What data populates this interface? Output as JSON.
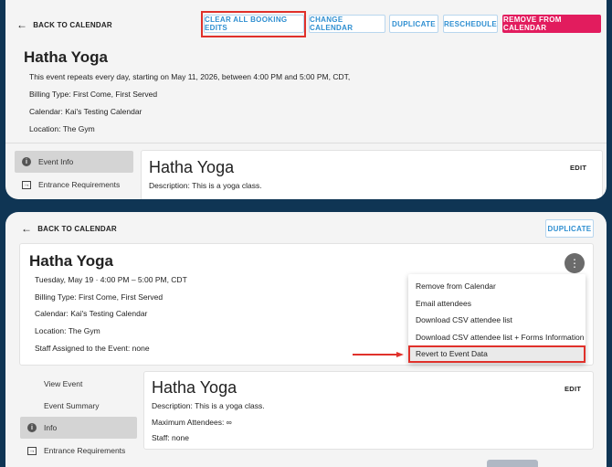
{
  "panel1": {
    "back_label": "BACK TO CALENDAR",
    "toolbar": {
      "clear_label": "CLEAR ALL BOOKING EDITS",
      "change_label": "CHANGE CALENDAR",
      "duplicate_label": "DUPLICATE",
      "reschedule_label": "RESCHEDULE",
      "remove_label": "REMOVE FROM CALENDAR"
    },
    "event_title": "Hatha Yoga",
    "repeat_text": "This event repeats every day, starting on May 11, 2026, between 4:00 PM and 5:00 PM, CDT,",
    "billing": "Billing Type: First Come, First Served",
    "calendar": "Calendar: Kai's Testing Calendar",
    "location": "Location: The Gym",
    "sidebar": [
      {
        "label": "Event Info"
      },
      {
        "label": "Entrance Requirements"
      }
    ],
    "detail_title": "Hatha Yoga",
    "edit_label": "EDIT",
    "description": "Description:  This is a yoga class."
  },
  "panel2": {
    "back_label": "BACK TO CALENDAR",
    "duplicate_label": "DUPLICATE",
    "event_title": "Hatha Yoga",
    "date_text": "Tuesday, May 19   ·   4:00 PM – 5:00 PM, CDT",
    "billing": "Billing Type: First Come, First Served",
    "calendar": "Calendar: Kai's Testing Calendar",
    "location": "Location: The Gym",
    "staff_assigned": "Staff Assigned to the Event: none",
    "menu": [
      {
        "label": "Remove from Calendar"
      },
      {
        "label": "Email attendees"
      },
      {
        "label": "Download CSV attendee list"
      },
      {
        "label": "Download CSV attendee list + Forms Information"
      },
      {
        "label": "Revert to Event Data"
      }
    ],
    "sidebar": [
      {
        "label": "View Event"
      },
      {
        "label": "Event Summary"
      },
      {
        "label": "Info"
      },
      {
        "label": "Entrance Requirements"
      }
    ],
    "detail_title": "Hatha Yoga",
    "edit_label": "EDIT",
    "description": "Description:  This is a yoga class.",
    "max_attendees": "Maximum Attendees: ∞",
    "staff": "Staff: none"
  },
  "colors": {
    "background": "#0f3554",
    "accent_blue": "#2f8fd1",
    "danger": "#e21c5e",
    "highlight_red": "#e0312b"
  },
  "icons": [
    "back-arrow-icon",
    "info-icon",
    "entrance-icon",
    "more-vertical-icon",
    "red-arrow-icon"
  ]
}
